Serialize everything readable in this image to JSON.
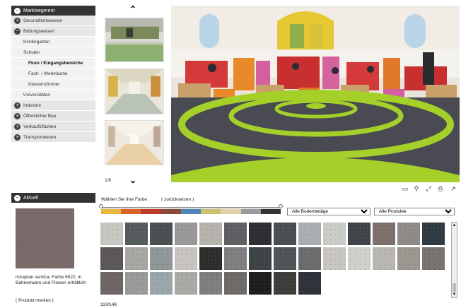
{
  "sidebar": {
    "header": "Marktsegment",
    "items": [
      {
        "label": "Gesundheitswesen",
        "level": 0,
        "expanded": false
      },
      {
        "label": "Bildungswesen",
        "level": 0,
        "expanded": true
      },
      {
        "label": "Kindergarten",
        "level": 1
      },
      {
        "label": "Schulen",
        "level": 1
      },
      {
        "label": "Flure / Eingangsbereiche",
        "level": 2,
        "active": true
      },
      {
        "label": "Fach- / Werkräume",
        "level": 2
      },
      {
        "label": "Klassenzimmer",
        "level": 2
      },
      {
        "label": "Universitäten",
        "level": 1
      },
      {
        "label": "Industrie",
        "level": 0,
        "expanded": false
      },
      {
        "label": "Öffentlicher Bau",
        "level": 0,
        "expanded": false
      },
      {
        "label": "Verkaufsflächen",
        "level": 0,
        "expanded": false
      },
      {
        "label": "Transportwesen",
        "level": 0,
        "expanded": false
      }
    ]
  },
  "gallery": {
    "counter": "1/6",
    "up_icon": "chevron-up-icon",
    "down_icon": "chevron-down-icon"
  },
  "toolbar": {
    "icons": [
      "monitor-icon",
      "zoom-icon",
      "fullscreen-icon",
      "print-icon",
      "share-icon"
    ]
  },
  "current": {
    "header": "Aktuell",
    "description": "noraplan sentica, Farbe 6522, in Bahnenware und Fliesen erhältlich",
    "bookmark": "( Produkt merken )",
    "swatch_color": "#7a6a6a"
  },
  "filter": {
    "label": "Wählen Sie Ihre Farbe",
    "reset": "( zurücksetzen )",
    "colors": [
      "#e8b93a",
      "#d9652a",
      "#c0392b",
      "#8a4a3a",
      "#4f86b8",
      "#c9c36a",
      "#e3d0a8",
      "#9a9a9a",
      "#333333"
    ],
    "flooring_select": "Alle Bodenbeläge",
    "product_select": "Alle Produkte"
  },
  "swatches": [
    "#c8c6c1",
    "#555a5d",
    "#4c4f52",
    "#9a9896",
    "#b5b2ab",
    "#5e5f62",
    "#2d2e31",
    "#4a4d52",
    "#a9aeb0",
    "#c9cbc7",
    "#3e4448",
    "#7e6f6b",
    "#8d8a88",
    "#2f3a40",
    "#5b5758",
    "#a9a7a3",
    "#8f9799",
    "#c7c4bf",
    "#2e2d2c",
    "#7f7f80",
    "#3d4347",
    "#4f5457",
    "#6b6c6e",
    "#c9c6bf",
    "#cfd0cb",
    "#b7b6b1",
    "#9c9690",
    "#7a7370",
    "#6f6565",
    "#9a9a9a",
    "#9aa6aa",
    "#a9aaa6",
    "#7f7e7f",
    "#6e6a68",
    "#1d1d1f",
    "#3d3c3b",
    "#2f3238"
  ],
  "result_count": "119/148"
}
